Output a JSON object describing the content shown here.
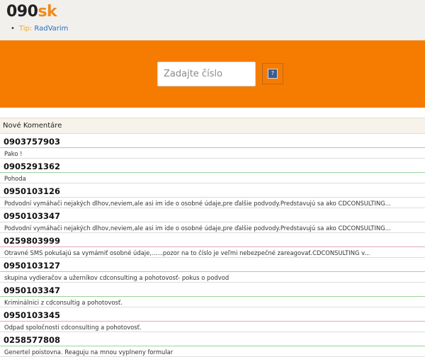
{
  "logo": {
    "part1": "090",
    "part2": "sk"
  },
  "tip": {
    "bullet": "•",
    "label": "Tip:",
    "link": "RadVarim"
  },
  "search": {
    "placeholder": "Zadajte číslo",
    "button_glyph": "?"
  },
  "section": {
    "title": "Nové Komentáre"
  },
  "colors": {
    "orange": "#f57c00",
    "accent": "#f28a1c",
    "link": "#2d6fb8"
  },
  "comments": [
    {
      "number": "0903757903",
      "text": "Pako !",
      "sep": "red"
    },
    {
      "number": "0905291362",
      "text": "Pohoda",
      "sep": "green"
    },
    {
      "number": "0950103126",
      "text": "Podvodní vymáhači nejakých dlhov,neviem,ale asi im ide o osobné údaje,pre ďalšie podvody.Predstavujú sa ako CDCONSULTING...",
      "sep": "gray"
    },
    {
      "number": "0950103347",
      "text": "Podvodní vymáhači nejakých dlhov,neviem,ale asi im ide o osobné údaje,pre ďalšie podvody.Predstavujú sa ako CDCONSULTING...",
      "sep": "gray"
    },
    {
      "number": "0259803999",
      "text": "Otravné SMS pokušajú sa vymámiť osobné údaje,......pozor na to číslo je veľmi nebezpečné zareagovať.CDCONSULTING v...",
      "sep": "red"
    },
    {
      "number": "0950103127",
      "text": "skupina vydieračov a užerníkov cdconsulting a pohotovosť- pokus o podvod",
      "sep": "red"
    },
    {
      "number": "0950103347",
      "text": "Kriminálnici z cdconsultig a pohotovosť.",
      "sep": "green"
    },
    {
      "number": "0950103345",
      "text": "Odpad spoločnosti cdconsulting a pohotovosť.",
      "sep": "red"
    },
    {
      "number": "0258577808",
      "text": "Genertel poistovna. Reaguju na mnou vyplneny formular",
      "sep": "green"
    }
  ]
}
